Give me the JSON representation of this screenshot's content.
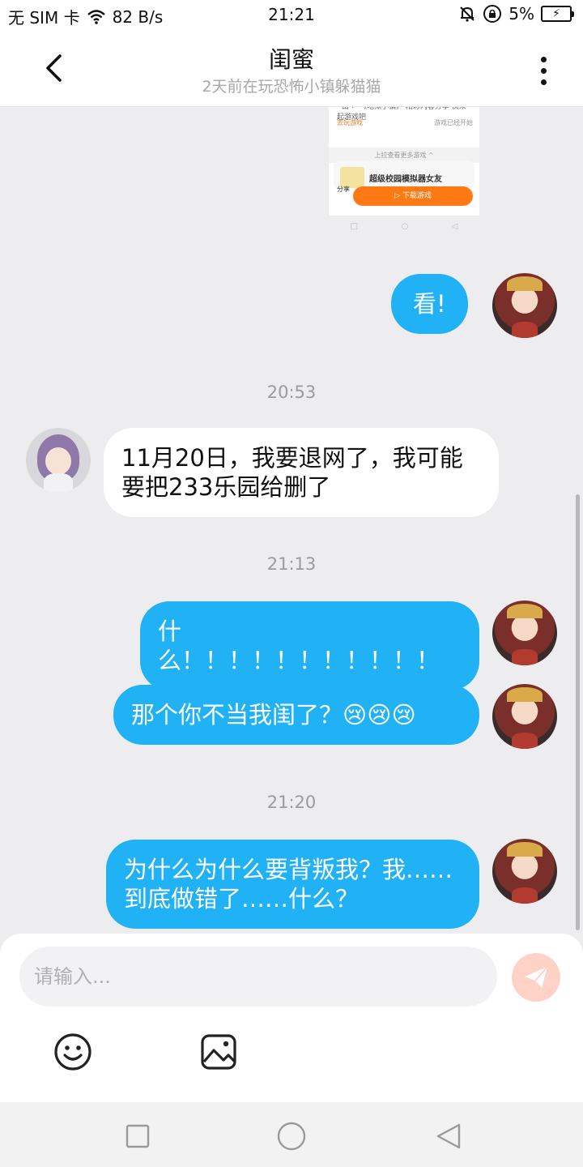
{
  "status_bar": {
    "carrier": "无 SIM 卡",
    "network_speed": "82 B/s",
    "time": "21:21",
    "battery": "5%"
  },
  "header": {
    "title": "闺蜜",
    "subtitle": "2天前在玩恐怖小镇躲猫猫"
  },
  "shared_card": {
    "text": "ʻ 山 ↩ 《地狱小镇》 精彩内容分享 快来一起游戏吧",
    "left_action": "去玩游戏",
    "right_action": "游戏已经开始",
    "more_recommendations": "上拉查看更多游戏 ^",
    "game_title": "超级校园模拟器女友",
    "share_label": "分享",
    "download_label": "▷ 下载游戏"
  },
  "messages": [
    {
      "sender": "me",
      "text": "看!"
    },
    {
      "timestamp": "20:53"
    },
    {
      "sender": "friend",
      "text_line1": "11月20日，我要退网了，我可能",
      "text_line2": "要把233乐园给删了"
    },
    {
      "timestamp": "21:13"
    },
    {
      "sender": "me",
      "text": "什么！！！！！！！！！！！"
    },
    {
      "sender": "me",
      "text": "那个你不当我闺了？😢😢😢"
    },
    {
      "timestamp": "21:20"
    },
    {
      "sender": "me",
      "text_line1": "为什么为什么要背叛我？我……",
      "text_line2": "到底做错了……什么？"
    }
  ],
  "input": {
    "placeholder": "请输入..."
  },
  "icons": {
    "back": "chevron-left-icon",
    "more": "more-vertical-icon",
    "send": "send-icon",
    "emoji": "emoji-icon",
    "image": "image-icon"
  },
  "colors": {
    "my_bubble": "#20b2f4",
    "friend_bubble": "#ffffff",
    "send_button": "#ffd2c8"
  }
}
